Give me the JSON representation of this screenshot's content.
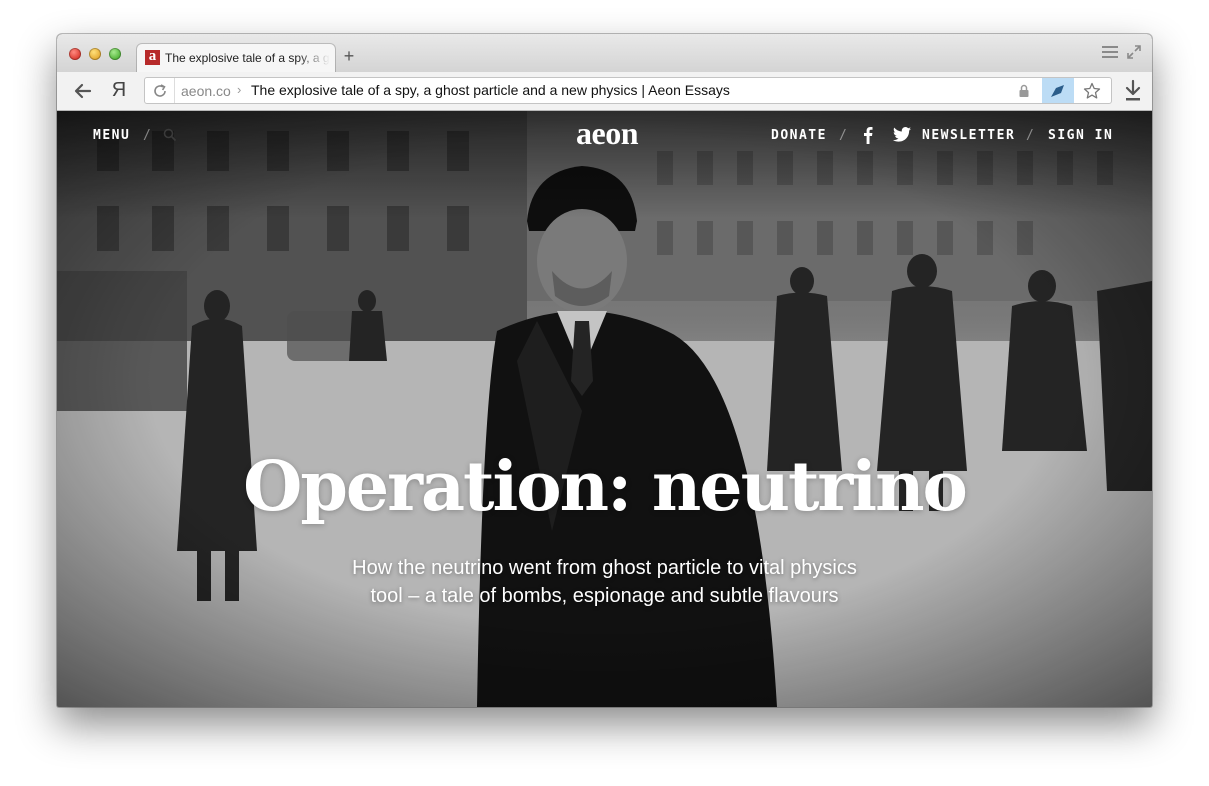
{
  "browser": {
    "tab_favicon_letter": "a",
    "tab_title": "The explosive tale of a spy, a ghost particle and a new physics | Aeon Essays",
    "new_tab_symbol": "+",
    "yandex_symbol": "Я",
    "address": {
      "domain": "aeon.co",
      "chevron": "›",
      "title": "The explosive tale of a spy, a ghost particle and a new physics | Aeon Essays"
    },
    "colors": {
      "cast_button_bg": "#bcdcf5",
      "favicon_bg": "#b72a2a"
    }
  },
  "page": {
    "nav": {
      "menu": "MENU",
      "slash": "/",
      "donate": "DONATE",
      "newsletter": "NEWSLETTER",
      "sign_in": "SIGN IN"
    },
    "logo": "aeon",
    "headline": "Operation: neutrino",
    "standfirst": "How the neutrino went from ghost particle to vital physics tool – a tale of bombs, espionage and subtle flavours"
  }
}
